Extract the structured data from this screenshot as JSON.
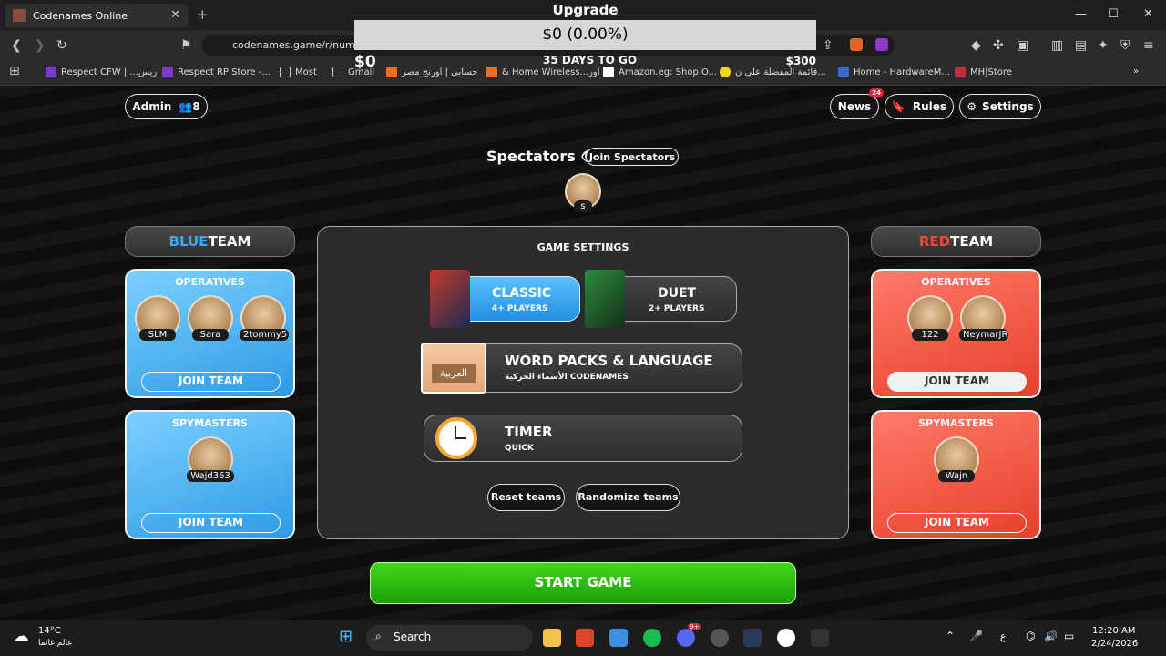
{
  "browser": {
    "tab_title": "Codenames Online",
    "url": "codenames.game/r/numo"
  },
  "overlay": {
    "title": "Upgrade",
    "amount": "$0 (0.00%)",
    "left": "$0",
    "mid": "35 DAYS TO GO",
    "right": "$300"
  },
  "bookmarks": [
    "Respect CFW | ...ريس",
    "Respect RP Store -...",
    "Most",
    "Gmail",
    "حسابي | اورنج مصر",
    "& Home Wireless...اور",
    "Amazon.eg: Shop O...",
    "قائمة المفضلة على ن...",
    "Home - HardwareM...",
    "MH|Store"
  ],
  "header": {
    "admin": "Admin",
    "count": "8",
    "news": "News",
    "news_badge": "24",
    "rules": "Rules",
    "settings": "Settings"
  },
  "spectators": {
    "label": "Spectators",
    "join": "Join Spectators",
    "member": "s"
  },
  "blue": {
    "word1": "BLUE",
    "word2": "TEAM",
    "operatives": "OPERATIVES",
    "players": [
      "SLM",
      "Sara",
      "2tommy5"
    ],
    "spymasters": "SPYMASTERS",
    "spymaster": "Wajd363",
    "join": "JOIN TEAM"
  },
  "red": {
    "word1": "RED",
    "word2": "TEAM",
    "operatives": "OPERATIVES",
    "players": [
      "122",
      "NeymarJR"
    ],
    "spymasters": "SPYMASTERS",
    "spymaster": "Wajn",
    "join": "JOIN TEAM"
  },
  "settings": {
    "title": "GAME SETTINGS",
    "classic": "CLASSIC",
    "classic_sub": "4+ PLAYERS",
    "duet": "DUET",
    "duet_sub": "2+ PLAYERS",
    "word": "WORD PACKS & LANGUAGE",
    "word_sub": "الأسماء الحركية CODENAMES",
    "word_icon": "العربية",
    "timer": "TIMER",
    "timer_sub": "QUICK",
    "reset": "Reset teams",
    "randomize": "Randomize teams"
  },
  "start": "START GAME",
  "taskbar": {
    "temp": "14°C",
    "weather": "عالم غائما",
    "search": "Search",
    "time": "12:20 AM",
    "date": "2/24/2026",
    "lang": "ع",
    "discord_badge": "9+"
  },
  "colors": {
    "blue_accent": "#3eaaf5",
    "red_accent": "#ee4b35",
    "start_green": "#2fc512"
  }
}
